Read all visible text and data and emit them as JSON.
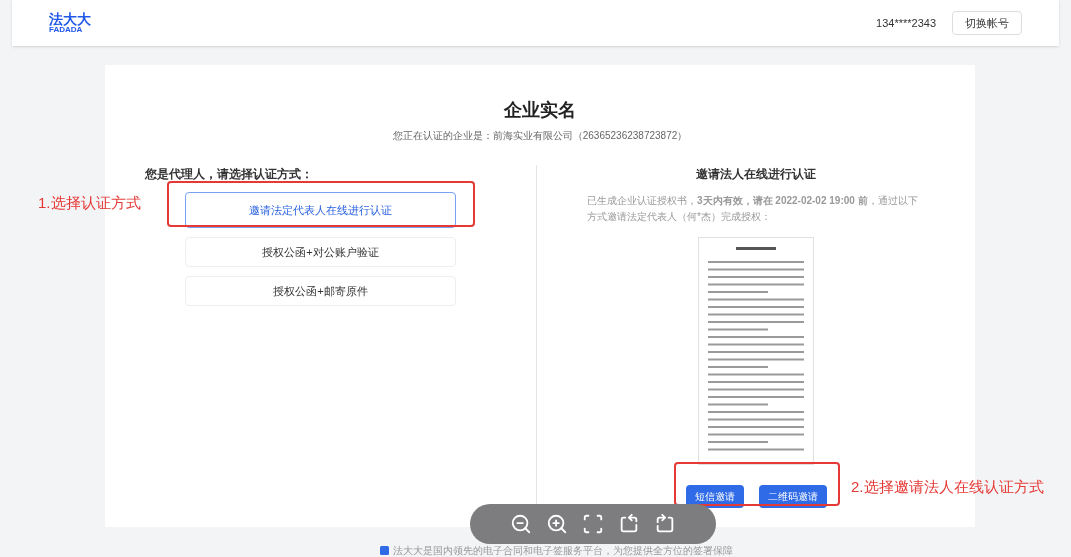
{
  "header": {
    "logo": {
      "text": "法大大",
      "subtext": "FADADA"
    },
    "account": "134****2343",
    "switch_button": "切换帐号"
  },
  "page": {
    "title": "企业实名",
    "subtitle": "您正在认证的企业是：前海实业有限公司（26365236238723872）"
  },
  "left": {
    "heading": "您是代理人，请选择认证方式：",
    "options": [
      {
        "label": "邀请法定代表人在线进行认证",
        "selected": true
      },
      {
        "label": "授权公函+对公账户验证",
        "selected": false
      },
      {
        "label": "授权公函+邮寄原件",
        "selected": false
      }
    ]
  },
  "right": {
    "heading": "邀请法人在线进行认证",
    "notice": "已生成企业认证授权书，**3天内有效，请在 2022-02-02 19:00 前**，通过以下方式邀请法定代表人（何*杰）完成授权：",
    "buttons": [
      "短信邀请",
      "二维码邀请"
    ]
  },
  "annotations": [
    {
      "label": "1.选择认证方式"
    },
    {
      "label": "2.选择邀请法人在线认证方式"
    }
  ],
  "footer": "法大大是国内领先的电子合同和电子签服务平台，为您提供全方位的签署保障"
}
